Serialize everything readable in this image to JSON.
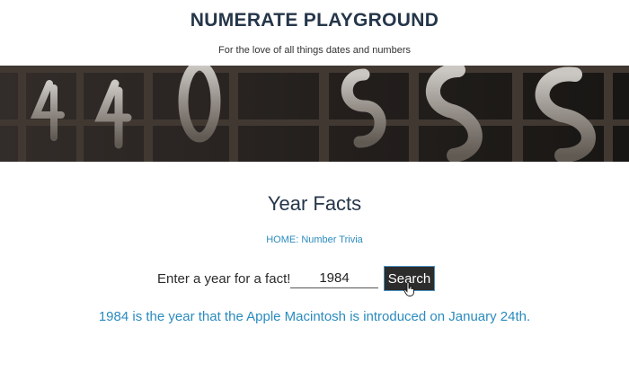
{
  "header": {
    "title": "NUMERATE PLAYGROUND",
    "tagline": "For the love of all things dates and numbers"
  },
  "banner": {
    "icon": "metal-numbers-photo"
  },
  "main": {
    "page_title": "Year Facts",
    "breadcrumb": "HOME: Number Trivia",
    "form": {
      "label": "Enter a year for a fact!",
      "year_value": "1984",
      "button_label": "Search"
    },
    "result": "1984 is the year that the Apple Macintosh is introduced on January 24th."
  },
  "colors": {
    "title": "#25364a",
    "link": "#2a8bbf",
    "button_bg": "#2c2c2c"
  }
}
